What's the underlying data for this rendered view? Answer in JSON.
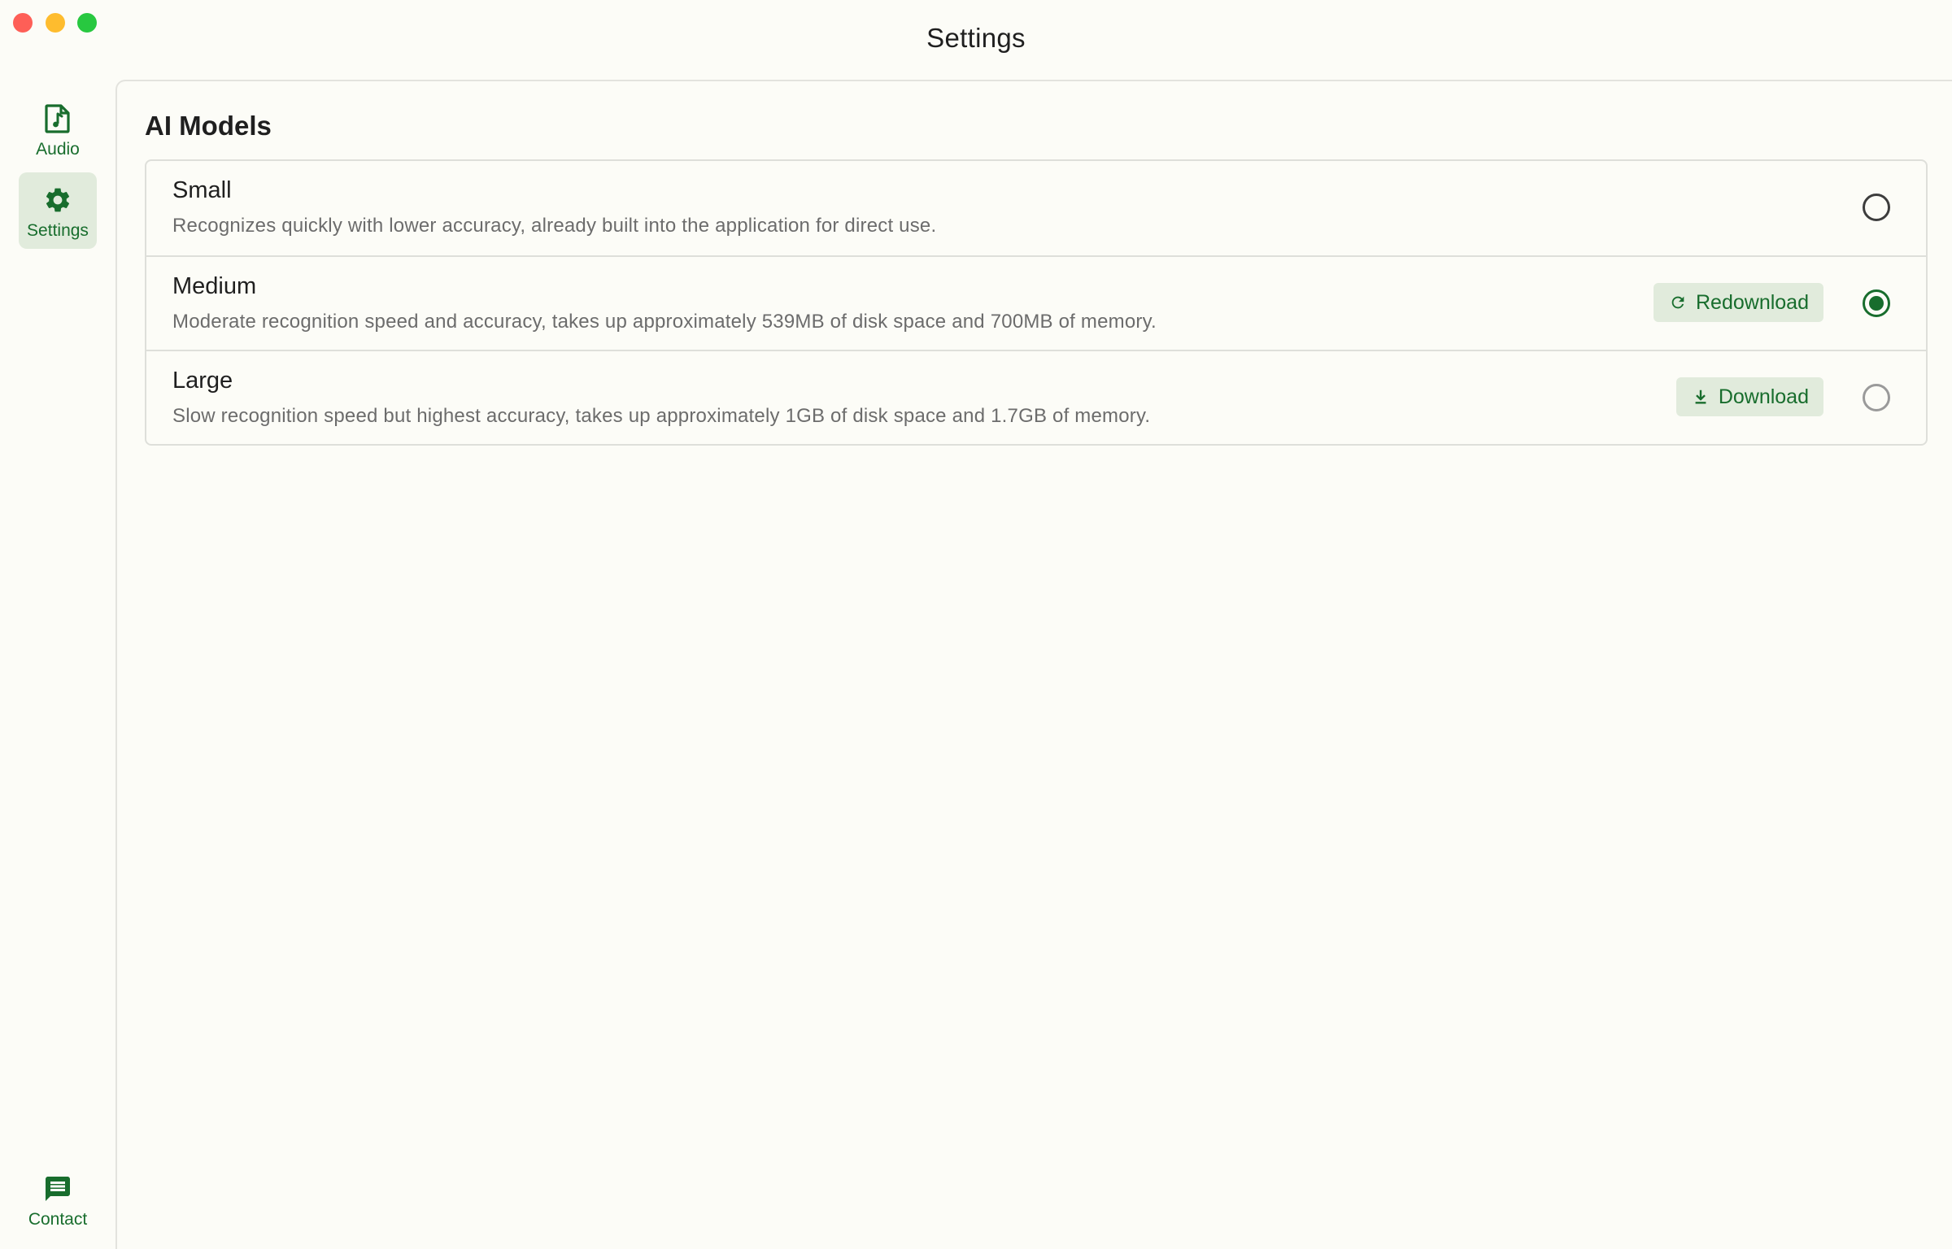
{
  "window": {
    "title": "Settings"
  },
  "sidebar": {
    "items": [
      {
        "label": "Audio",
        "icon": "music-file-icon"
      },
      {
        "label": "Settings",
        "icon": "gear-icon",
        "active": true
      }
    ],
    "footer": {
      "label": "Contact",
      "icon": "chat-icon"
    }
  },
  "section": {
    "title": "AI Models"
  },
  "models": [
    {
      "name": "Small",
      "description": "Recognizes quickly with lower accuracy, already built into the application for direct use.",
      "selected": false
    },
    {
      "name": "Medium",
      "description": "Moderate recognition speed and accuracy, takes up approximately 539MB of disk space and 700MB of memory.",
      "action_label": "Redownload",
      "action_icon": "refresh-icon",
      "selected": true
    },
    {
      "name": "Large",
      "description": "Slow recognition speed but highest accuracy, takes up approximately 1GB of disk space and 1.7GB of memory.",
      "action_label": "Download",
      "action_icon": "download-icon",
      "selected": false
    }
  ],
  "colors": {
    "accent": "#186d2d",
    "accent_bg": "#e1ebdc",
    "background": "#fcfcf7"
  }
}
